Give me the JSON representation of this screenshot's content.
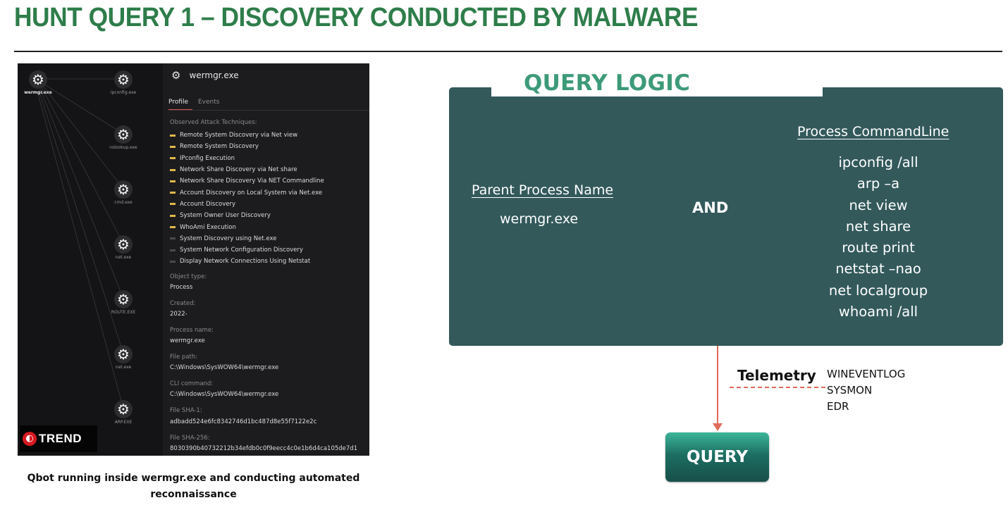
{
  "title": "HUNT QUERY 1 – DISCOVERY CONDUCTED BY MALWARE",
  "screenshot": {
    "graph_nodes": [
      {
        "label": "wermgr.exe"
      },
      {
        "label": "ipconfig.exe"
      },
      {
        "label": "nslookup.exe"
      },
      {
        "label": "cmd.exe"
      },
      {
        "label": "net.exe"
      },
      {
        "label": "ROUTE.EXE"
      },
      {
        "label": "net.exe"
      },
      {
        "label": "ARP.EXE"
      }
    ],
    "logo_text": "TREND",
    "process_title": "wermgr.exe",
    "tabs": [
      "Profile",
      "Events"
    ],
    "observed_label": "Observed Attack Techniques:",
    "techniques": [
      {
        "name": "Remote System Discovery via Net view",
        "color": "#e0b84a"
      },
      {
        "name": "Remote System Discovery",
        "color": "#e0b84a"
      },
      {
        "name": "IPconfig Execution",
        "color": "#e0b84a"
      },
      {
        "name": "Network Share Discovery via Net share",
        "color": "#e0b84a"
      },
      {
        "name": "Network Share Discovery Via NET Commandline",
        "color": "#e0b84a"
      },
      {
        "name": "Account Discovery on Local System via Net.exe",
        "color": "#e0b84a"
      },
      {
        "name": "Account Discovery",
        "color": "#e0b84a"
      },
      {
        "name": "System Owner User Discovery",
        "color": "#e0b84a"
      },
      {
        "name": "WhoAmi Execution",
        "color": "#e0b84a"
      },
      {
        "name": "System Discovery using Net.exe",
        "color": "#4a4a4a"
      },
      {
        "name": "System Network Configuration Discovery",
        "color": "#4a4a4a"
      },
      {
        "name": "Display Network Connections Using Netstat",
        "color": "#4a4a4a"
      }
    ],
    "object_type_label": "Object type:",
    "object_type": "Process",
    "created_label": "Created:",
    "created": "2022-",
    "process_name_label": "Process name:",
    "process_name": "wermgr.exe",
    "file_path_label": "File path:",
    "file_path": "C:\\Windows\\SysWOW64\\wermgr.exe",
    "cli_label": "CLI command:",
    "cli": "C:\\Windows\\SysWOW64\\wermgr.exe",
    "sha1_label": "File SHA-1:",
    "sha1": "adbadd524e6fc8342746d1bc487d8e55f7122e2c",
    "sha256_label": "File SHA-256:",
    "sha256": "8030390b40732212b34efdb0c0f9eecc4c0e1b6d4ca105de7d1"
  },
  "caption_line1": "Qbot running inside wermgr.exe and conducting automated",
  "caption_line2": "reconnaissance",
  "logic": {
    "title": "QUERY LOGIC",
    "parent_header": "Parent Process Name",
    "parent_value": "wermgr.exe",
    "operator": "AND",
    "cmd_header": "Process CommandLine",
    "commands": [
      "ipconfig /all",
      "arp –a",
      "net view",
      "net share",
      "route print",
      "netstat –nao",
      "net localgroup",
      "whoami /all"
    ]
  },
  "telemetry": {
    "label": "Telemetry",
    "sources": [
      "WINEVENTLOG",
      "SYSMON",
      "EDR"
    ]
  },
  "query_button": "QUERY"
}
